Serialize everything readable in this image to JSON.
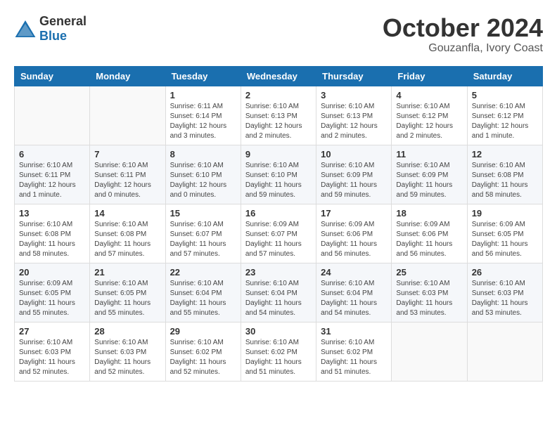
{
  "logo": {
    "general": "General",
    "blue": "Blue"
  },
  "header": {
    "month": "October 2024",
    "location": "Gouzanfla, Ivory Coast"
  },
  "weekdays": [
    "Sunday",
    "Monday",
    "Tuesday",
    "Wednesday",
    "Thursday",
    "Friday",
    "Saturday"
  ],
  "weeks": [
    [
      {
        "day": "",
        "info": ""
      },
      {
        "day": "",
        "info": ""
      },
      {
        "day": "1",
        "info": "Sunrise: 6:11 AM\nSunset: 6:14 PM\nDaylight: 12 hours and 3 minutes."
      },
      {
        "day": "2",
        "info": "Sunrise: 6:10 AM\nSunset: 6:13 PM\nDaylight: 12 hours and 2 minutes."
      },
      {
        "day": "3",
        "info": "Sunrise: 6:10 AM\nSunset: 6:13 PM\nDaylight: 12 hours and 2 minutes."
      },
      {
        "day": "4",
        "info": "Sunrise: 6:10 AM\nSunset: 6:12 PM\nDaylight: 12 hours and 2 minutes."
      },
      {
        "day": "5",
        "info": "Sunrise: 6:10 AM\nSunset: 6:12 PM\nDaylight: 12 hours and 1 minute."
      }
    ],
    [
      {
        "day": "6",
        "info": "Sunrise: 6:10 AM\nSunset: 6:11 PM\nDaylight: 12 hours and 1 minute."
      },
      {
        "day": "7",
        "info": "Sunrise: 6:10 AM\nSunset: 6:11 PM\nDaylight: 12 hours and 0 minutes."
      },
      {
        "day": "8",
        "info": "Sunrise: 6:10 AM\nSunset: 6:10 PM\nDaylight: 12 hours and 0 minutes."
      },
      {
        "day": "9",
        "info": "Sunrise: 6:10 AM\nSunset: 6:10 PM\nDaylight: 11 hours and 59 minutes."
      },
      {
        "day": "10",
        "info": "Sunrise: 6:10 AM\nSunset: 6:09 PM\nDaylight: 11 hours and 59 minutes."
      },
      {
        "day": "11",
        "info": "Sunrise: 6:10 AM\nSunset: 6:09 PM\nDaylight: 11 hours and 59 minutes."
      },
      {
        "day": "12",
        "info": "Sunrise: 6:10 AM\nSunset: 6:08 PM\nDaylight: 11 hours and 58 minutes."
      }
    ],
    [
      {
        "day": "13",
        "info": "Sunrise: 6:10 AM\nSunset: 6:08 PM\nDaylight: 11 hours and 58 minutes."
      },
      {
        "day": "14",
        "info": "Sunrise: 6:10 AM\nSunset: 6:08 PM\nDaylight: 11 hours and 57 minutes."
      },
      {
        "day": "15",
        "info": "Sunrise: 6:10 AM\nSunset: 6:07 PM\nDaylight: 11 hours and 57 minutes."
      },
      {
        "day": "16",
        "info": "Sunrise: 6:09 AM\nSunset: 6:07 PM\nDaylight: 11 hours and 57 minutes."
      },
      {
        "day": "17",
        "info": "Sunrise: 6:09 AM\nSunset: 6:06 PM\nDaylight: 11 hours and 56 minutes."
      },
      {
        "day": "18",
        "info": "Sunrise: 6:09 AM\nSunset: 6:06 PM\nDaylight: 11 hours and 56 minutes."
      },
      {
        "day": "19",
        "info": "Sunrise: 6:09 AM\nSunset: 6:05 PM\nDaylight: 11 hours and 56 minutes."
      }
    ],
    [
      {
        "day": "20",
        "info": "Sunrise: 6:09 AM\nSunset: 6:05 PM\nDaylight: 11 hours and 55 minutes."
      },
      {
        "day": "21",
        "info": "Sunrise: 6:10 AM\nSunset: 6:05 PM\nDaylight: 11 hours and 55 minutes."
      },
      {
        "day": "22",
        "info": "Sunrise: 6:10 AM\nSunset: 6:04 PM\nDaylight: 11 hours and 55 minutes."
      },
      {
        "day": "23",
        "info": "Sunrise: 6:10 AM\nSunset: 6:04 PM\nDaylight: 11 hours and 54 minutes."
      },
      {
        "day": "24",
        "info": "Sunrise: 6:10 AM\nSunset: 6:04 PM\nDaylight: 11 hours and 54 minutes."
      },
      {
        "day": "25",
        "info": "Sunrise: 6:10 AM\nSunset: 6:03 PM\nDaylight: 11 hours and 53 minutes."
      },
      {
        "day": "26",
        "info": "Sunrise: 6:10 AM\nSunset: 6:03 PM\nDaylight: 11 hours and 53 minutes."
      }
    ],
    [
      {
        "day": "27",
        "info": "Sunrise: 6:10 AM\nSunset: 6:03 PM\nDaylight: 11 hours and 52 minutes."
      },
      {
        "day": "28",
        "info": "Sunrise: 6:10 AM\nSunset: 6:03 PM\nDaylight: 11 hours and 52 minutes."
      },
      {
        "day": "29",
        "info": "Sunrise: 6:10 AM\nSunset: 6:02 PM\nDaylight: 11 hours and 52 minutes."
      },
      {
        "day": "30",
        "info": "Sunrise: 6:10 AM\nSunset: 6:02 PM\nDaylight: 11 hours and 51 minutes."
      },
      {
        "day": "31",
        "info": "Sunrise: 6:10 AM\nSunset: 6:02 PM\nDaylight: 11 hours and 51 minutes."
      },
      {
        "day": "",
        "info": ""
      },
      {
        "day": "",
        "info": ""
      }
    ]
  ]
}
